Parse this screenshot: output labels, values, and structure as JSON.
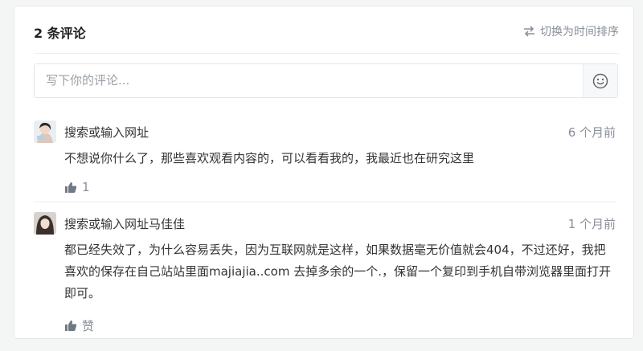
{
  "header": {
    "title": "2 条评论",
    "sort_label": "切换为时间排序",
    "sort_icon": "swap-arrows-icon"
  },
  "input": {
    "placeholder": "写下你的评论...",
    "emoji_icon": "smiley-icon"
  },
  "comments": [
    {
      "author": "搜索或输入网址",
      "time": "6 个月前",
      "text": "不想说你什么了，那些喜欢观看内容的，可以看看我的，我最近也在研究这里",
      "like_label": "1",
      "like_icon": "thumbs-up-icon"
    },
    {
      "author": "搜索或输入网址马佳佳",
      "time": "1 个月前",
      "text": "都已经失效了，为什么容易丢失，因为互联网就是这样，如果数据毫无价值就会404，不过还好，我把喜欢的保存在自己站站里面majiajia..com 去掉多余的一个.，保留一个复印到手机自带浏览器里面打开即可。",
      "like_label": "赞",
      "like_icon": "thumbs-up-icon"
    }
  ],
  "colors": {
    "muted": "#8a8f99",
    "text": "#333333",
    "border": "#e5e6eb"
  }
}
